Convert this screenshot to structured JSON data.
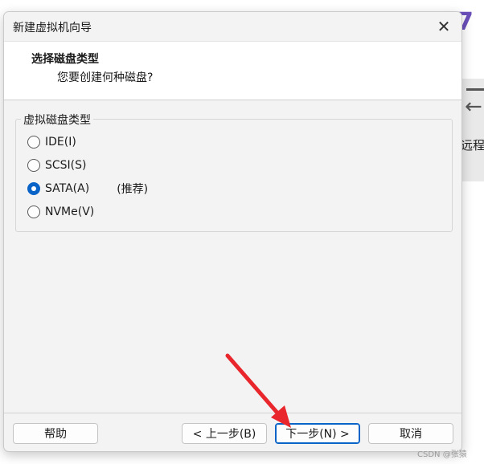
{
  "background_app": {
    "brand_fragment": "7",
    "card_text": "远程",
    "card_icon": "arrow-left-icon"
  },
  "dialog": {
    "title": "新建虚拟机向导",
    "close_icon": "close-icon",
    "header": {
      "title": "选择磁盘类型",
      "subtitle": "您要创建何种磁盘?"
    },
    "group": {
      "legend": "虚拟磁盘类型",
      "options": [
        {
          "label": "IDE(I)",
          "checked": false,
          "note": ""
        },
        {
          "label": "SCSI(S)",
          "checked": false,
          "note": ""
        },
        {
          "label": "SATA(A)",
          "checked": true,
          "note": "(推荐)"
        },
        {
          "label": "NVMe(V)",
          "checked": false,
          "note": ""
        }
      ]
    },
    "buttons": {
      "help": "帮助",
      "back": "< 上一步(B)",
      "next": "下一步(N) >",
      "cancel": "取消"
    }
  },
  "annotation": {
    "arrow_color": "#e8262b",
    "target": "next-button"
  },
  "watermark": "CSDN @张猿",
  "colors": {
    "accent": "#0a64c8",
    "brand": "#6b4fbb"
  }
}
